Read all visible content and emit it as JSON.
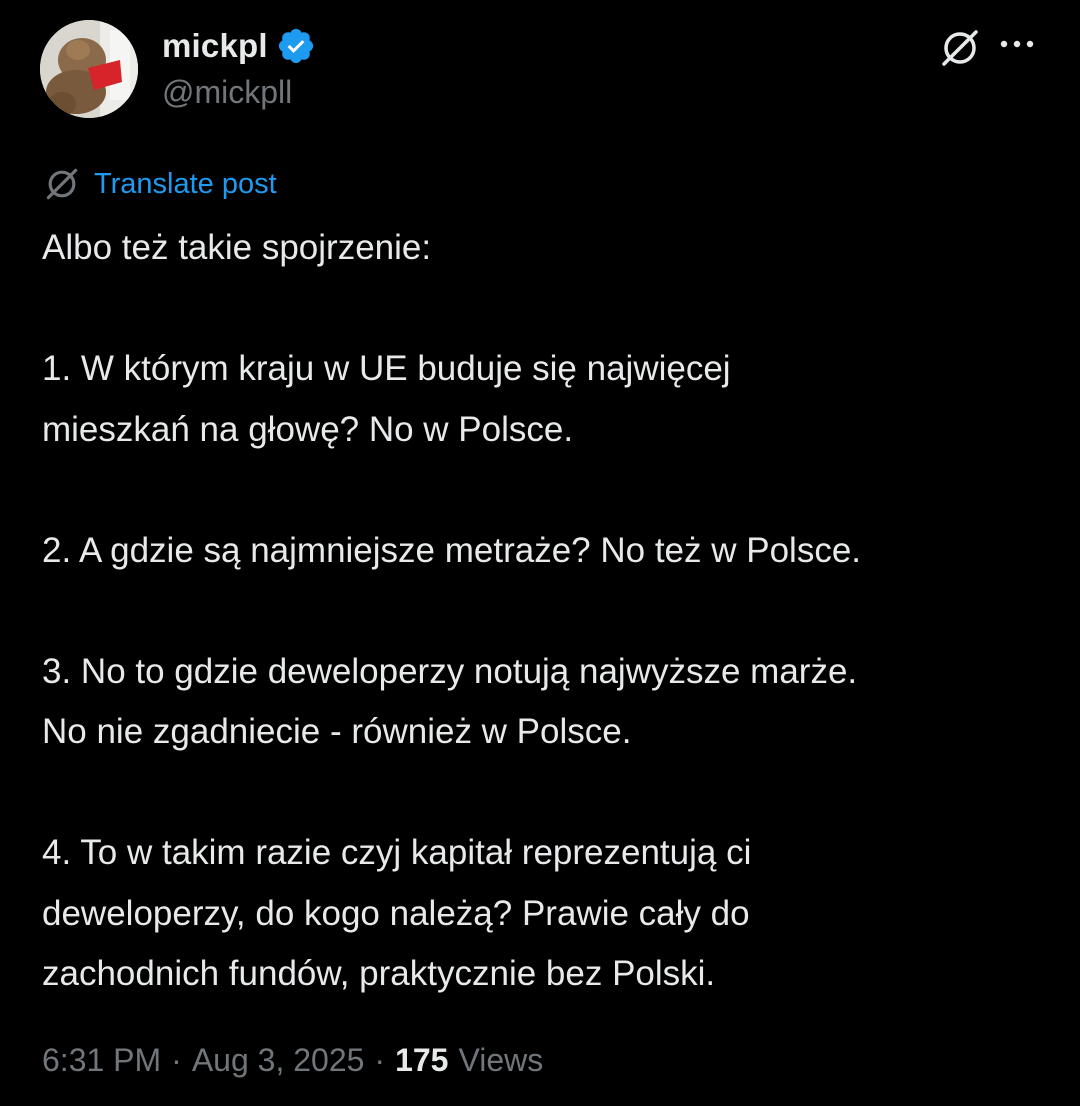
{
  "colors": {
    "background": "#000000",
    "text": "#e7e9ea",
    "muted": "#71767b",
    "link": "#1d9bf0",
    "verified": "#1d9bf0"
  },
  "author": {
    "display_name": "mickpl",
    "handle": "@mickpll",
    "verified": true
  },
  "actions": {
    "grok_icon": "grok-icon",
    "more_icon": "more-horizontal-icon"
  },
  "translate": {
    "label": "Translate post",
    "icon": "grok-icon"
  },
  "post": {
    "lines": [
      "Albo też takie spojrzenie:",
      "",
      "1. W którym kraju w UE buduje się najwięcej",
      "mieszkań na głowę? No w Polsce.",
      "",
      "2. A gdzie są najmniejsze metraże? No też w Polsce.",
      "",
      "3. No to gdzie deweloperzy notują najwyższe marże.",
      "No nie zgadniecie - również w Polsce.",
      "",
      "4. To w takim razie czyj kapitał reprezentują ci",
      "deweloperzy, do kogo należą? Prawie cały do",
      "zachodnich fundów, praktycznie bez Polski."
    ]
  },
  "meta": {
    "time": "6:31 PM",
    "separator": "·",
    "date": "Aug 3, 2025",
    "views_count": "175",
    "views_label": "Views"
  }
}
